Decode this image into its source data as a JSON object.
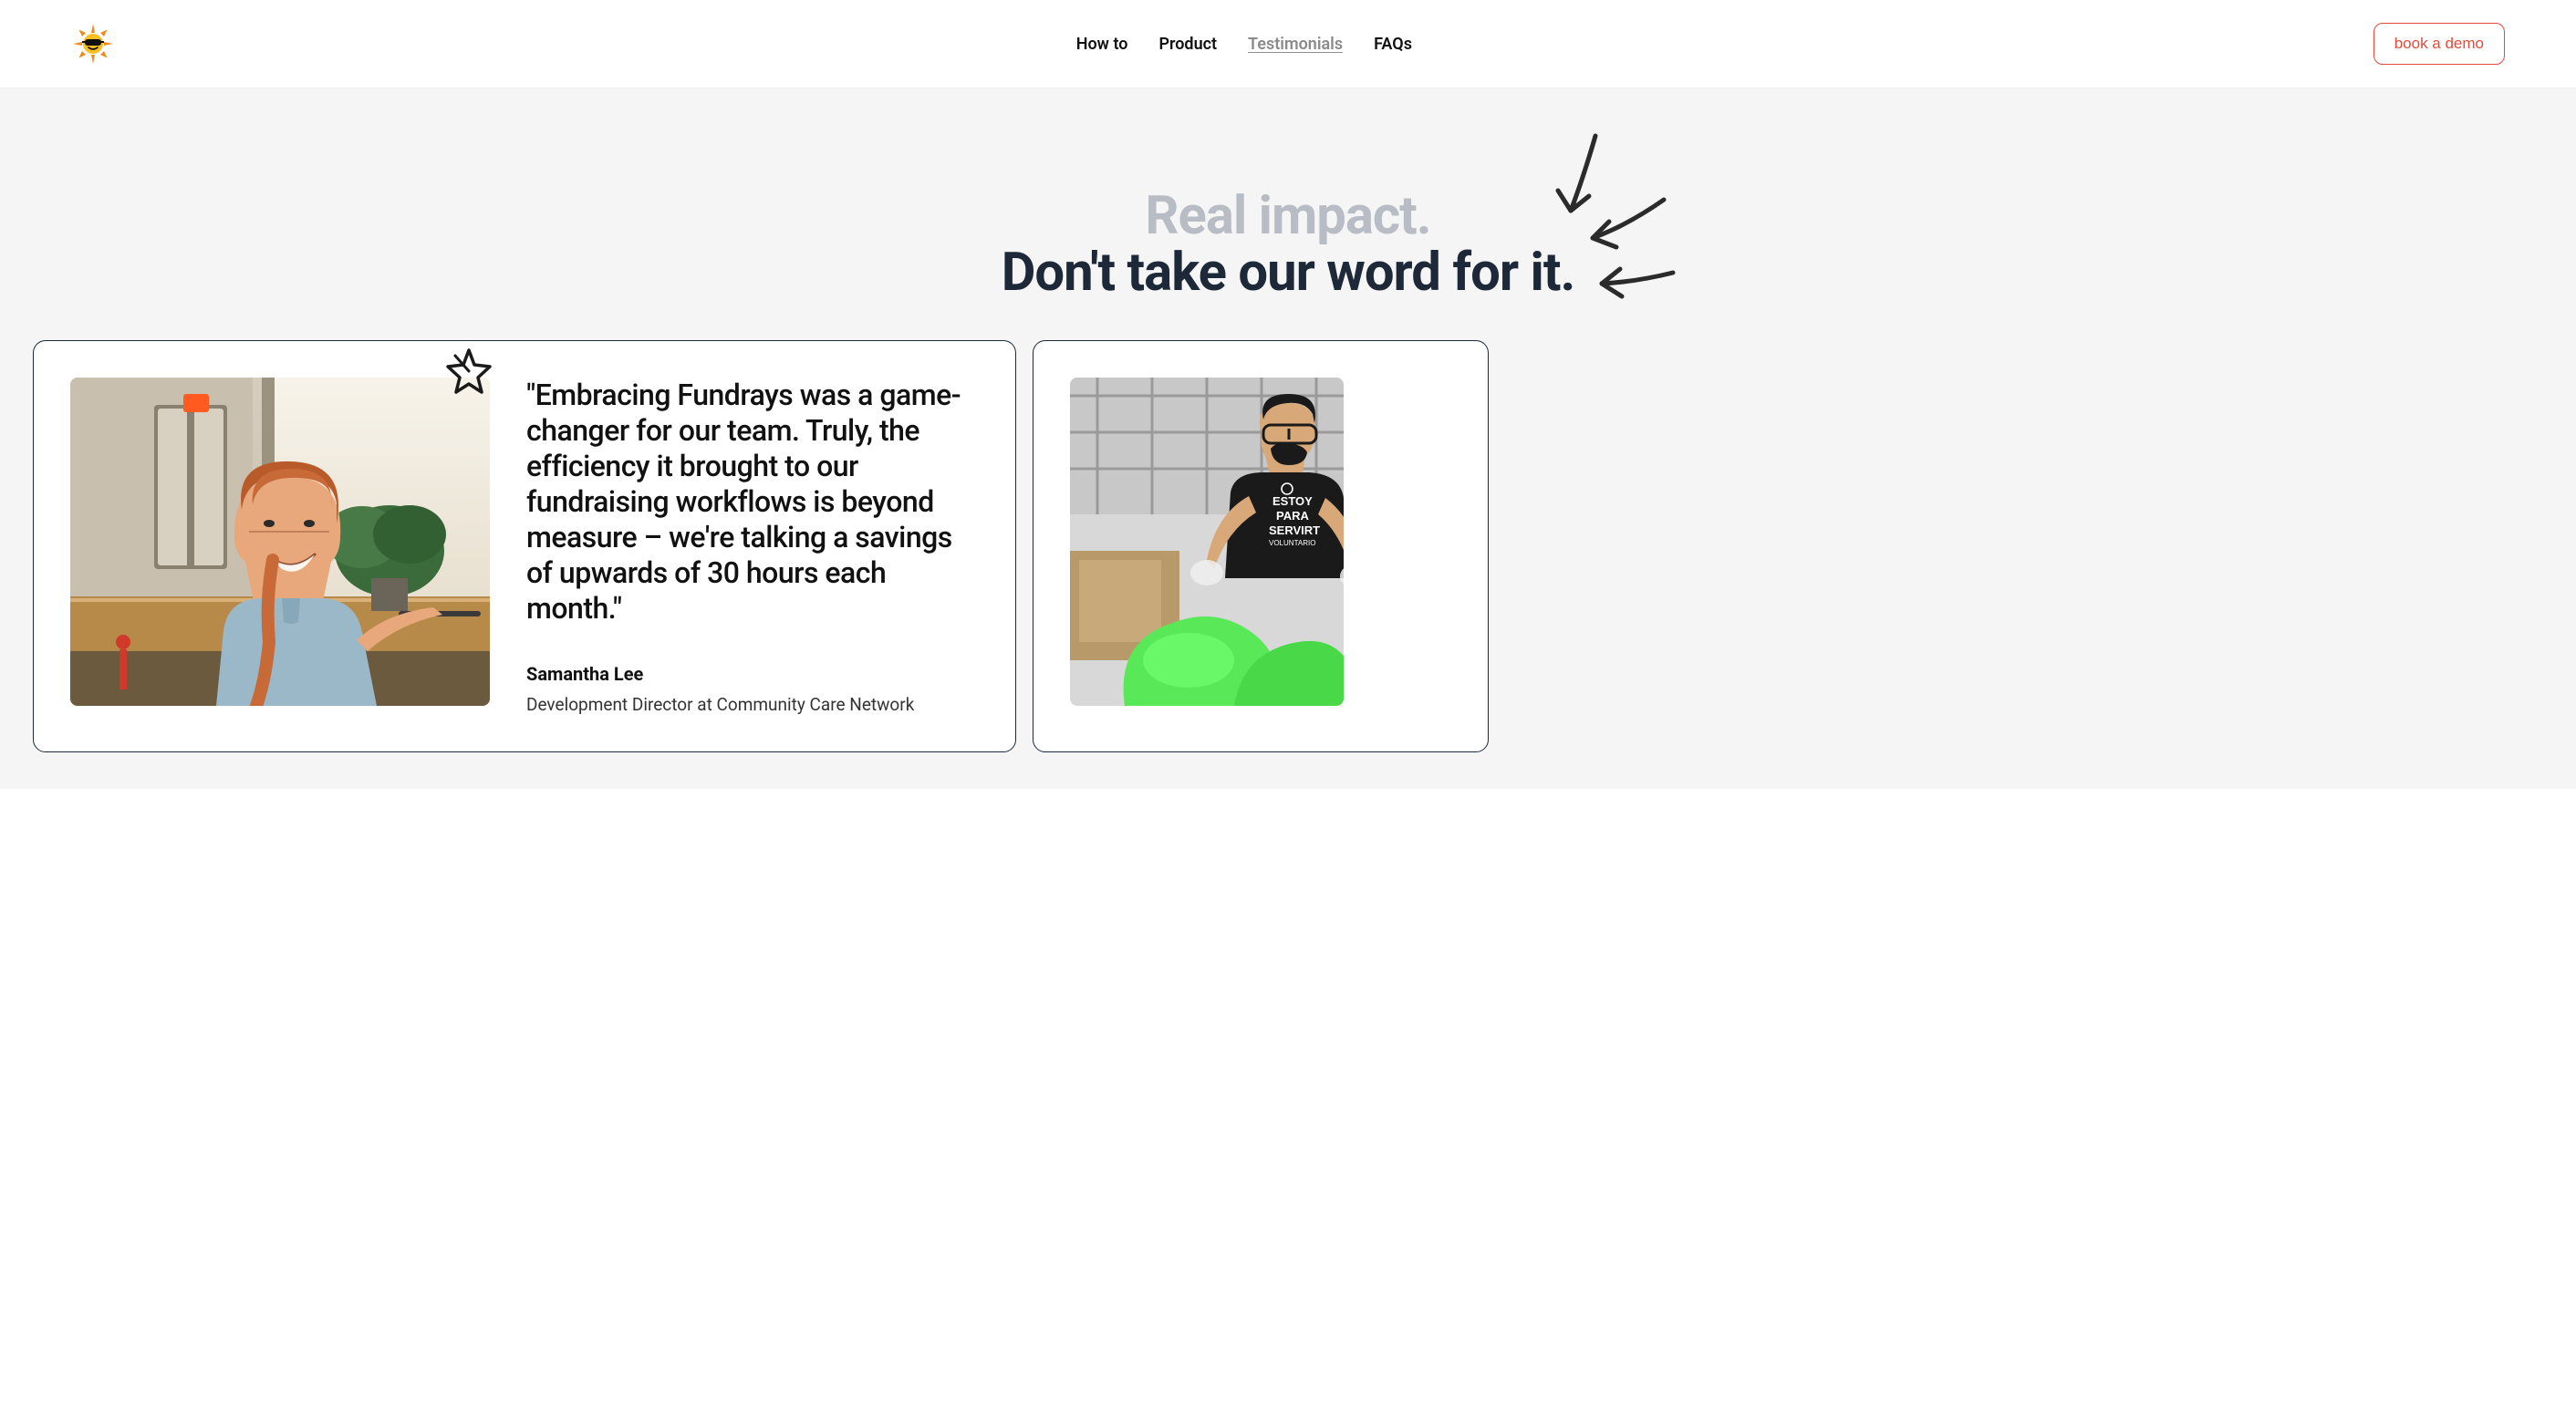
{
  "nav": {
    "items": [
      {
        "label": "How to",
        "active": false
      },
      {
        "label": "Product",
        "active": false
      },
      {
        "label": "Testimonials",
        "active": true
      },
      {
        "label": "FAQs",
        "active": false
      }
    ],
    "cta": "book a demo"
  },
  "hero": {
    "line1": "Real impact.",
    "line2": "Don't take our word for it."
  },
  "testimonials": [
    {
      "quote": "\"Embracing Fundrays was a game-changer for our team. Truly, the efficiency it brought to our fundraising workflows is beyond measure – we're talking a savings of upwards of 30 hours each month.\"",
      "name": "Samantha Lee",
      "title": "Development Director at Community Care Network"
    },
    {
      "quote": "",
      "name": "",
      "title": ""
    }
  ]
}
